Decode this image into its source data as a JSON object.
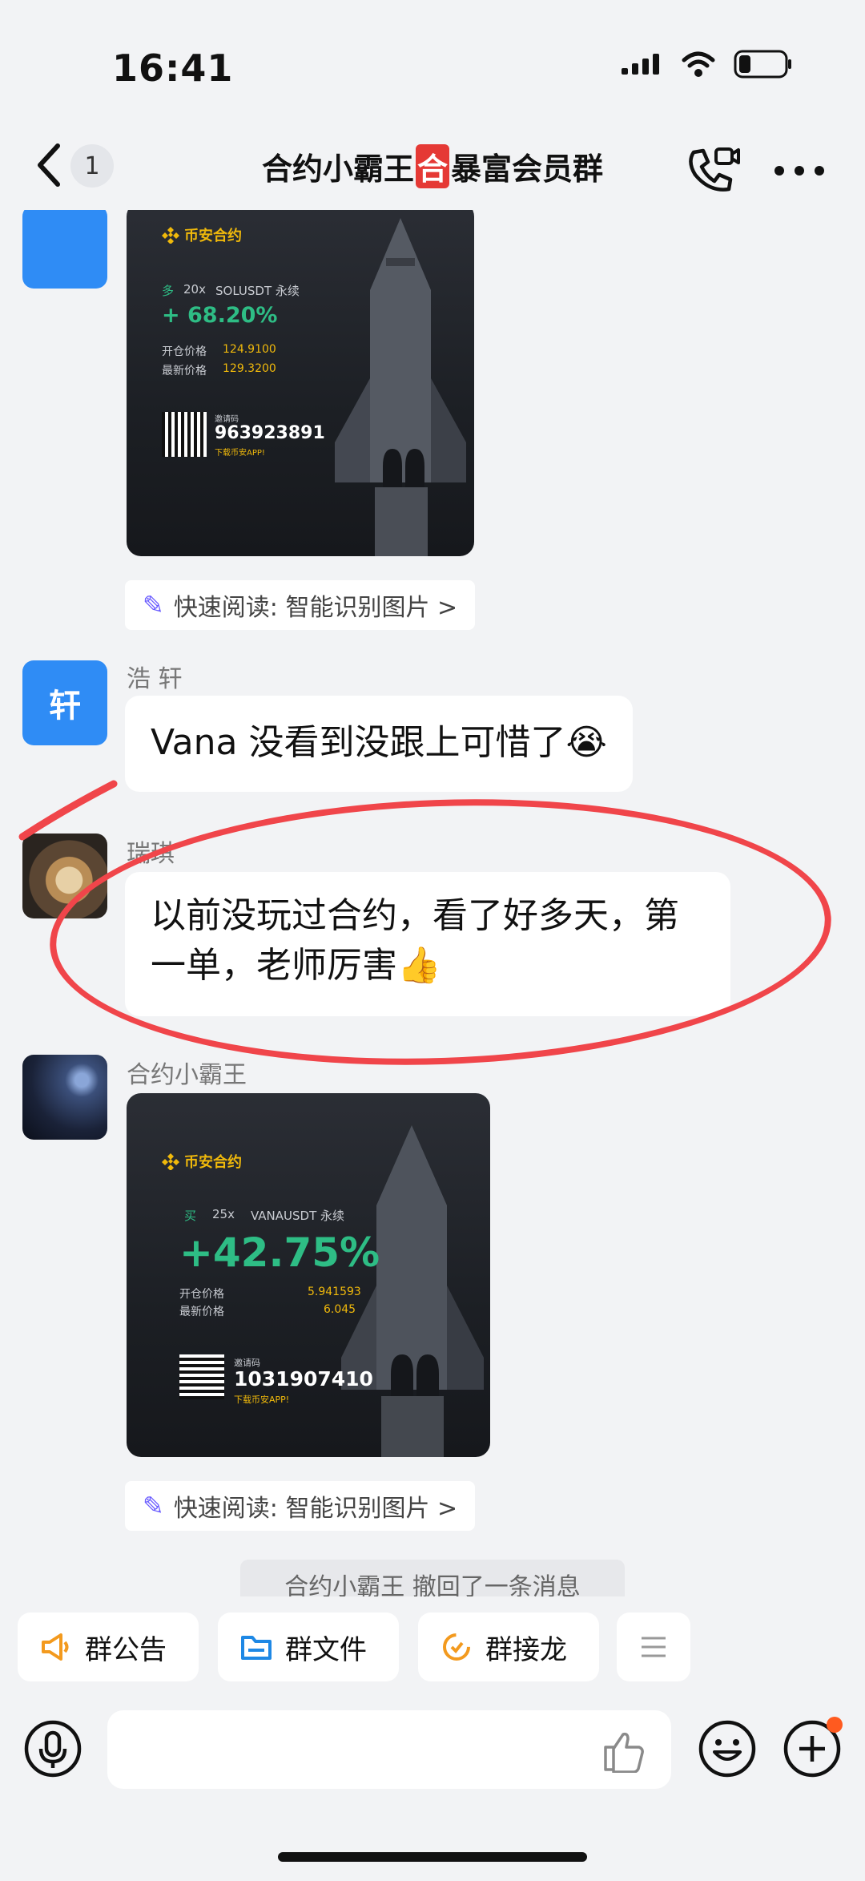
{
  "status_bar": {
    "time": "16:41"
  },
  "header": {
    "unread_count": "1",
    "title_prefix": "合约小霸王",
    "title_badge": "合",
    "title_suffix": "暴富会员群"
  },
  "messages": {
    "card1": {
      "logo_text": "币安合约",
      "direction": "多",
      "leverage": "20x",
      "symbol": "SOLUSDT 永续",
      "pnl": "+ 68.20%",
      "open_label": "开仓价格",
      "open_price": "124.9100",
      "last_label": "最新价格",
      "last_price": "129.3200",
      "invite_label": "邀请码",
      "invite_code": "963923891",
      "download": "下载币安APP!"
    },
    "quick_read_1": "快速阅读: 智能识别图片 >",
    "msg_haoxuan": {
      "avatar_char": "轩",
      "name": "浩 轩",
      "text": "Vana 没看到没跟上可惜了😭"
    },
    "msg_ruiqi": {
      "name": "瑞琪",
      "line1": "以前没玩过合约，看了好多天，第",
      "line2": "一单，老师厉害👍"
    },
    "msg_hy": {
      "name": "合约小霸王"
    },
    "card2": {
      "logo_text": "币安合约",
      "direction": "买",
      "leverage": "25x",
      "symbol": "VANAUSDT 永续",
      "pnl": "+42.75%",
      "open_label": "开仓价格",
      "open_price": "5.941593",
      "last_label": "最新价格",
      "last_price": "6.045",
      "invite_label": "邀请码",
      "invite_code": "1031907410",
      "download": "下载币安APP!"
    },
    "quick_read_2": "快速阅读: 智能识别图片 >",
    "recall_notice": "合约小霸王 撤回了一条消息"
  },
  "shortcuts": [
    {
      "label": "群公告",
      "icon": "megaphone-icon"
    },
    {
      "label": "群文件",
      "icon": "folder-icon"
    },
    {
      "label": "群接龙",
      "icon": "relay-icon"
    }
  ],
  "colors": {
    "accent_blue": "#2f8cf5",
    "annotation_red": "#f0454a",
    "profit_green": "#2ebd85",
    "binance_yellow": "#f0b90b"
  }
}
